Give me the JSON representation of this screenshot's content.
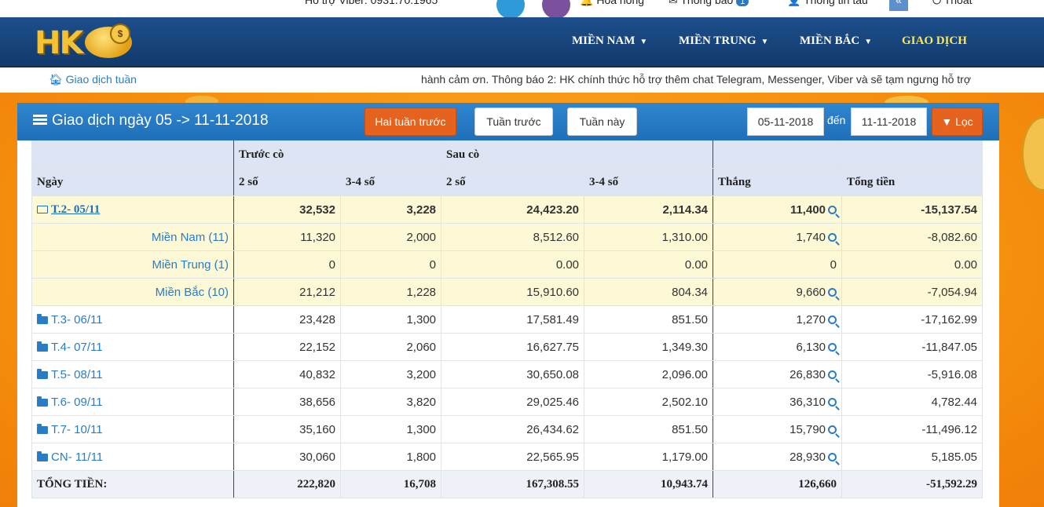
{
  "topbar": {
    "viber": "Hỗ trợ Viber: 0931.70.1965",
    "hoa_hong": "Hoa hồng",
    "thong_bao": "Thông báo",
    "thong_bao_count": "1",
    "thong_tin": "Thông tin tàu",
    "thoat": "Thoát"
  },
  "nav": {
    "logo_text": "HK",
    "coin_text": "$",
    "items": [
      "MIỀN NAM",
      "MIỀN TRUNG",
      "MIỀN BẮC",
      "GIAO DỊCH"
    ],
    "accent_color": "#ffe94a"
  },
  "breadcrumb": {
    "icon": "home-icon",
    "label": "Giao dịch tuần",
    "marquee": "hành cảm ơn. Thông báo 2: HK chính thức hỗ trợ thêm chat Telegram, Messenger, Viber và sẽ tạm ngưng hỗ trợ"
  },
  "panel": {
    "title": "Giao dịch ngày 05 -> 11-11-2018",
    "buttons": {
      "two_weeks": "Hai tuần trước",
      "last_week": "Tuần trước",
      "this_week": "Tuần này"
    },
    "from_date": "05-11-2018",
    "den": "đến",
    "to_date": "11-11-2018",
    "filter": "Lọc"
  },
  "table": {
    "group_headers": {
      "truoc_co": "Trước cò",
      "sau_co": "Sau cò"
    },
    "headers": [
      "Ngày",
      "2 số",
      "3-4 số",
      "2 số",
      "3-4 số",
      "Thắng",
      "Tổng tiền"
    ],
    "rows": [
      {
        "label": "T.2- 05/11",
        "v": [
          "32,532",
          "3,228",
          "24,423.20",
          "2,114.34",
          "11,400",
          "-15,137.54"
        ]
      },
      {
        "label": "Miền Nam (11)",
        "v": [
          "11,320",
          "2,000",
          "8,512.60",
          "1,310.00",
          "1,740",
          "-8,082.60"
        ]
      },
      {
        "label": "Miền Trung (1)",
        "v": [
          "0",
          "0",
          "0.00",
          "0.00",
          "0",
          "0.00"
        ]
      },
      {
        "label": "Miền Bắc (10)",
        "v": [
          "21,212",
          "1,228",
          "15,910.60",
          "804.34",
          "9,660",
          "-7,054.94"
        ]
      },
      {
        "label": "T.3- 06/11",
        "v": [
          "23,428",
          "1,300",
          "17,581.49",
          "851.50",
          "1,270",
          "-17,162.99"
        ]
      },
      {
        "label": "T.4- 07/11",
        "v": [
          "22,152",
          "2,060",
          "16,627.75",
          "1,349.30",
          "6,130",
          "-11,847.05"
        ]
      },
      {
        "label": "T.5- 08/11",
        "v": [
          "40,832",
          "3,200",
          "30,650.08",
          "2,096.00",
          "26,830",
          "-5,916.08"
        ]
      },
      {
        "label": "T.6- 09/11",
        "v": [
          "38,656",
          "3,820",
          "29,025.46",
          "2,502.10",
          "36,310",
          "4,782.44"
        ]
      },
      {
        "label": "T.7- 10/11",
        "v": [
          "35,160",
          "1,300",
          "26,434.62",
          "851.50",
          "15,790",
          "-11,496.12"
        ]
      },
      {
        "label": "CN- 11/11",
        "v": [
          "30,060",
          "1,800",
          "22,565.95",
          "1,179.00",
          "28,930",
          "5,185.05"
        ]
      }
    ],
    "total": {
      "label": "TỔNG TIỀN:",
      "v": [
        "222,820",
        "16,708",
        "167,308.55",
        "10,943.74",
        "126,660",
        "-51,592.29"
      ]
    }
  }
}
